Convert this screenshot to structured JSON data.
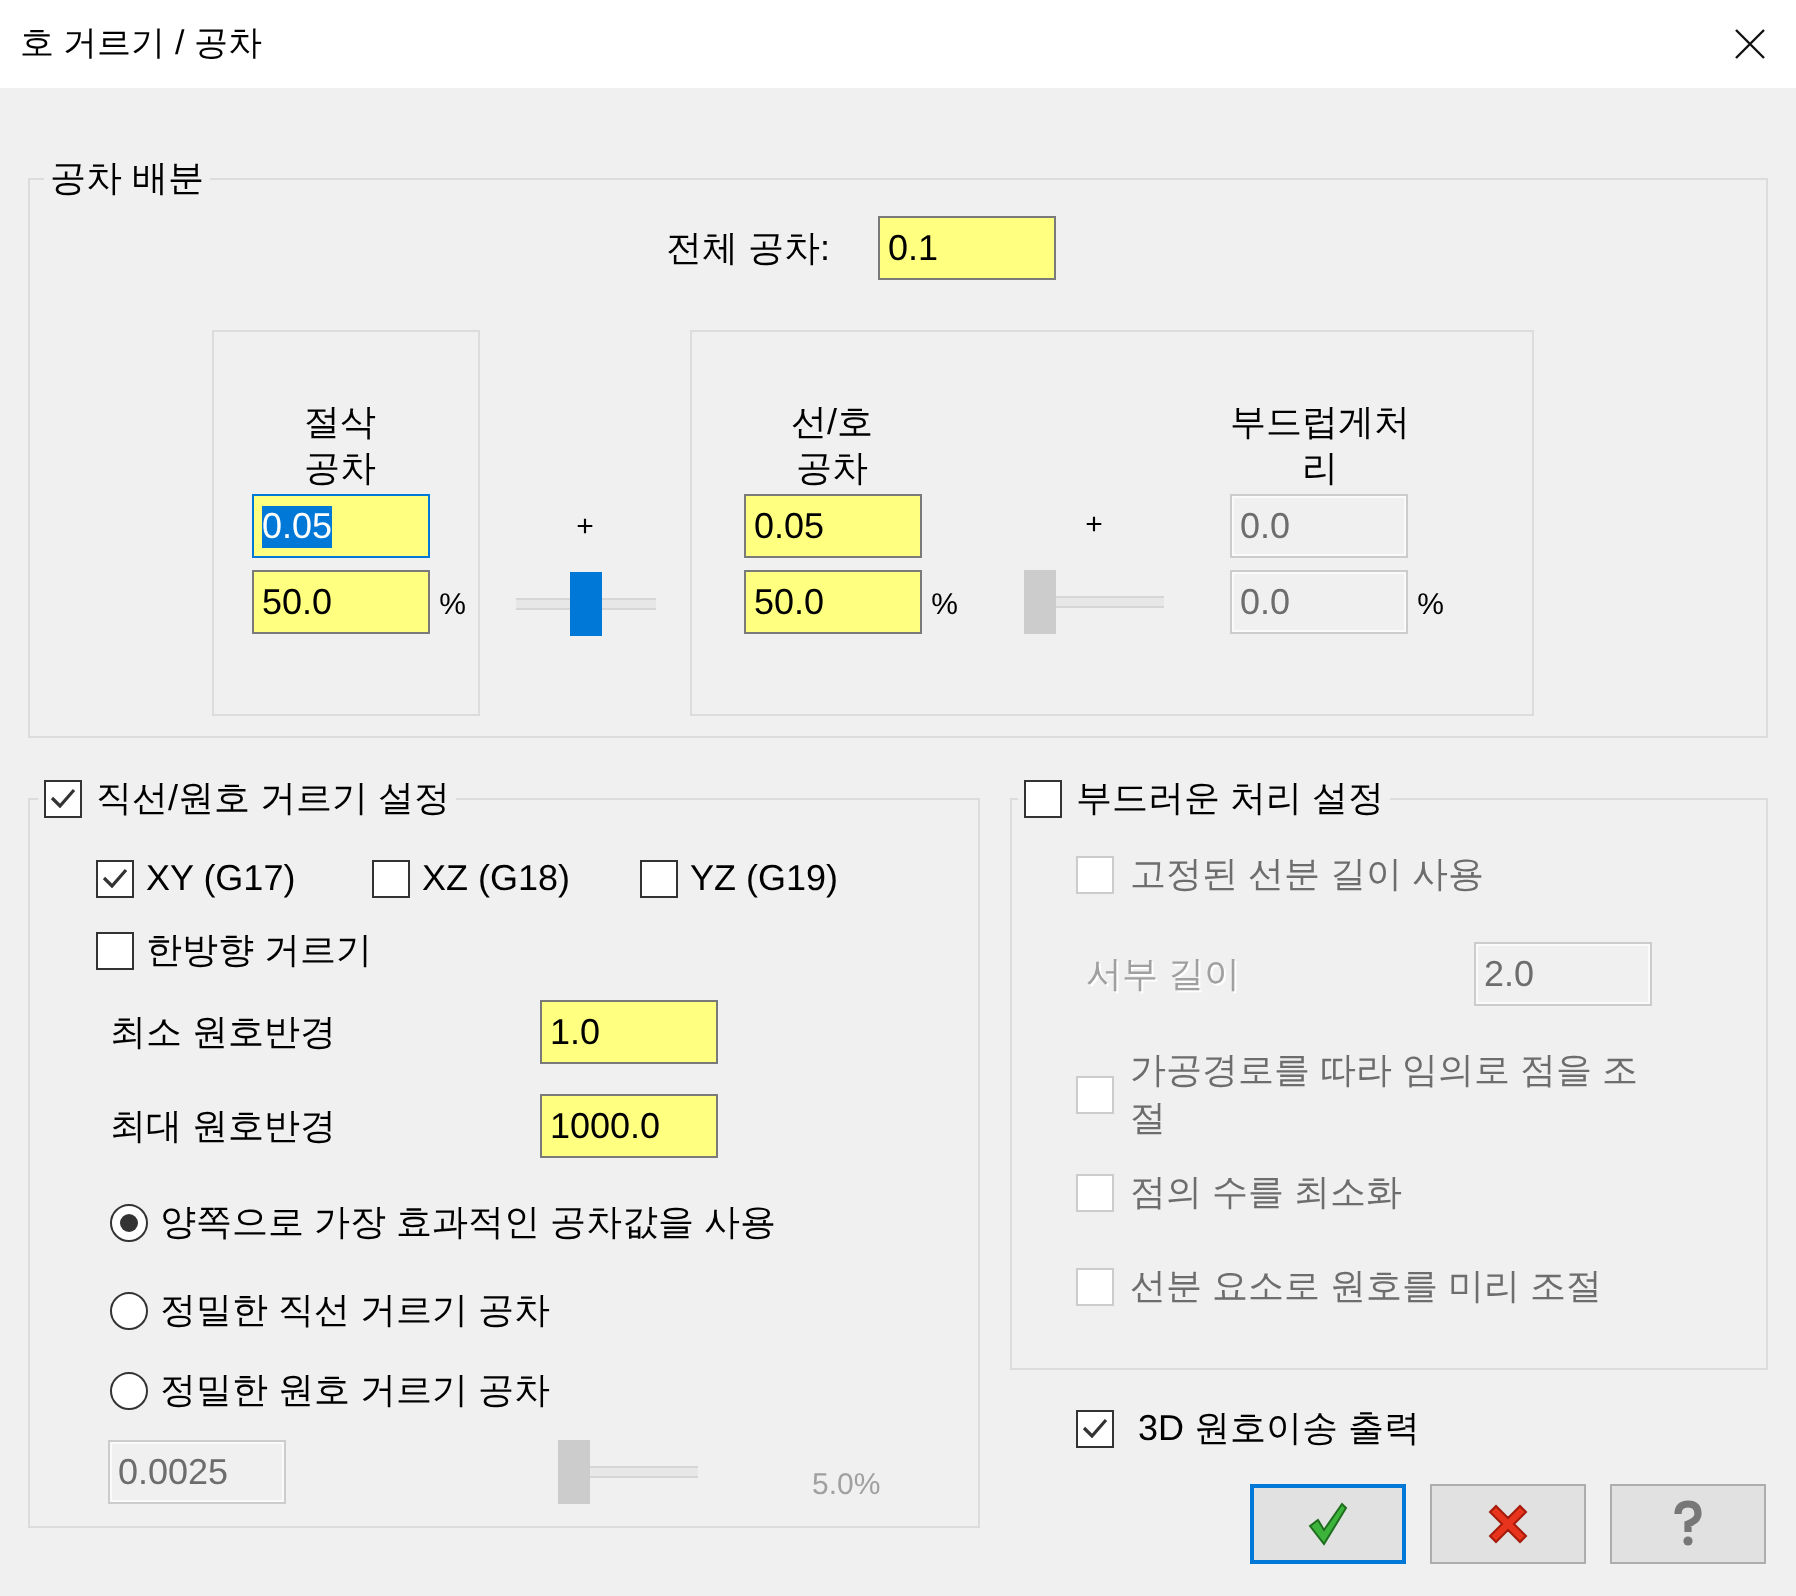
{
  "window": {
    "title": "호 거르기 / 공차"
  },
  "tolerance_distribution": {
    "title": "공차 배분",
    "total_label": "전체 공차:",
    "total_value": "0.1",
    "cutting": {
      "label": "절삭 공차",
      "value": "0.05",
      "focused": true,
      "percent": "50.0",
      "unit": "%",
      "disabled": false
    },
    "cutting_balance": {
      "plus": "+",
      "level": 0.5,
      "disabled": false
    },
    "line_arc": {
      "label": "선/호 공차",
      "value": "0.05",
      "focused": false,
      "percent": "50.0",
      "unit": "%",
      "disabled": false
    },
    "smoothing_balance": {
      "plus": "+",
      "level": 0,
      "disabled": true
    },
    "smoothing": {
      "label": "부드럽게처리",
      "value": "0.0",
      "focused": false,
      "percent": "0.0",
      "unit": "%",
      "disabled": true
    }
  },
  "line_arc_filter": {
    "label": "직선/원호 거르기 설정",
    "checked": true,
    "planes": [
      {
        "label": "XY (G17)",
        "checked": true
      },
      {
        "label": "XZ (G18)",
        "checked": false
      },
      {
        "label": "YZ (G19)",
        "checked": false
      }
    ],
    "one_way": {
      "label": "한방향 거르기",
      "checked": false
    },
    "min_radius": {
      "label": "최소 원호반경",
      "value": "1.0"
    },
    "max_radius": {
      "label": "최대 원호반경",
      "value": "1000.0"
    },
    "modes": [
      {
        "label": "양쪽으로 가장 효과적인 공차값을 사용",
        "selected": true
      },
      {
        "label": "정밀한 직선 거르기 공차",
        "selected": false
      },
      {
        "label": "정밀한 원호 거르기 공차",
        "selected": false
      }
    ],
    "precision": {
      "value": "0.0025",
      "level": 0,
      "reading": "5.0%",
      "disabled": true
    }
  },
  "smoothing_settings": {
    "label": "부드러운 처리 설정",
    "checked": false,
    "options": [
      {
        "kind": "checkbox",
        "label": "고정된 선분 길이 사용",
        "checked": false,
        "disabled": true
      },
      {
        "kind": "field",
        "label": "서부 길이",
        "value": "2.0",
        "disabled": true
      },
      {
        "kind": "checkbox",
        "label": "가공경로를 따라 임의로 점을 조절",
        "checked": false,
        "disabled": true
      },
      {
        "kind": "checkbox",
        "label": "점의 수를 최소화",
        "checked": false,
        "disabled": true
      },
      {
        "kind": "checkbox",
        "label": "선분 요소로 원호를 미리 조절",
        "checked": false,
        "disabled": true
      }
    ]
  },
  "output_3d_arc": {
    "label": "3D 원호이송 출력",
    "checked": true
  },
  "buttons": [
    {
      "kind": "ok",
      "default": true
    },
    {
      "kind": "cancel",
      "default": false
    },
    {
      "kind": "help",
      "default": false
    }
  ]
}
